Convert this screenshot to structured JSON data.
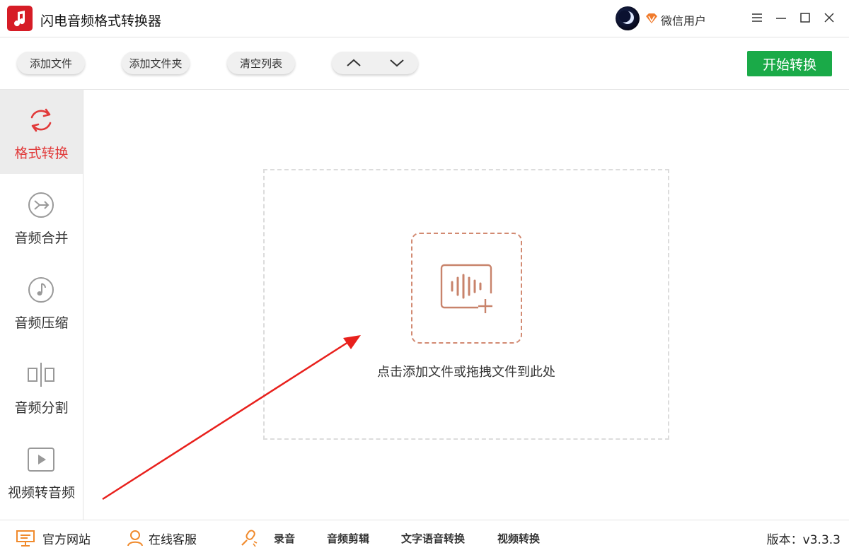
{
  "window": {
    "title": "闪电音频格式转换器",
    "user_name": "微信用户",
    "icons": {
      "logo": "music-note-icon",
      "vip": "diamond-icon",
      "menu": "menu-icon",
      "minimize": "minimize-icon",
      "maximize": "maximize-icon",
      "close": "close-icon"
    }
  },
  "toolbar": {
    "add_file": "添加文件",
    "add_folder": "添加文件夹",
    "clear_list": "清空列表",
    "move_up_icon": "chevron-up-icon",
    "move_down_icon": "chevron-down-icon",
    "start": "开始转换"
  },
  "sidebar": {
    "items": [
      {
        "label": "格式转换",
        "icon": "refresh-icon",
        "active": true
      },
      {
        "label": "音频合并",
        "icon": "merge-icon",
        "active": false
      },
      {
        "label": "音频压缩",
        "icon": "music-note-icon",
        "active": false
      },
      {
        "label": "音频分割",
        "icon": "split-icon",
        "active": false
      },
      {
        "label": "视频转音频",
        "icon": "play-icon",
        "active": false
      }
    ]
  },
  "main": {
    "drop_text": "点击添加文件或拖拽文件到此处",
    "add_icon": "audio-add-icon"
  },
  "bottom": {
    "website": "官方网站",
    "support": "在线客服",
    "record": "录音",
    "audio_edit": "音频剪辑",
    "tts": "文字语音转换",
    "video_convert": "视频转换",
    "version": "版本：v3.3.3"
  },
  "colors": {
    "accent_red": "#e13a3a",
    "start_green": "#1aaa48",
    "dashed_orange": "#d28a72",
    "annotation_arrow": "#e8201c"
  }
}
